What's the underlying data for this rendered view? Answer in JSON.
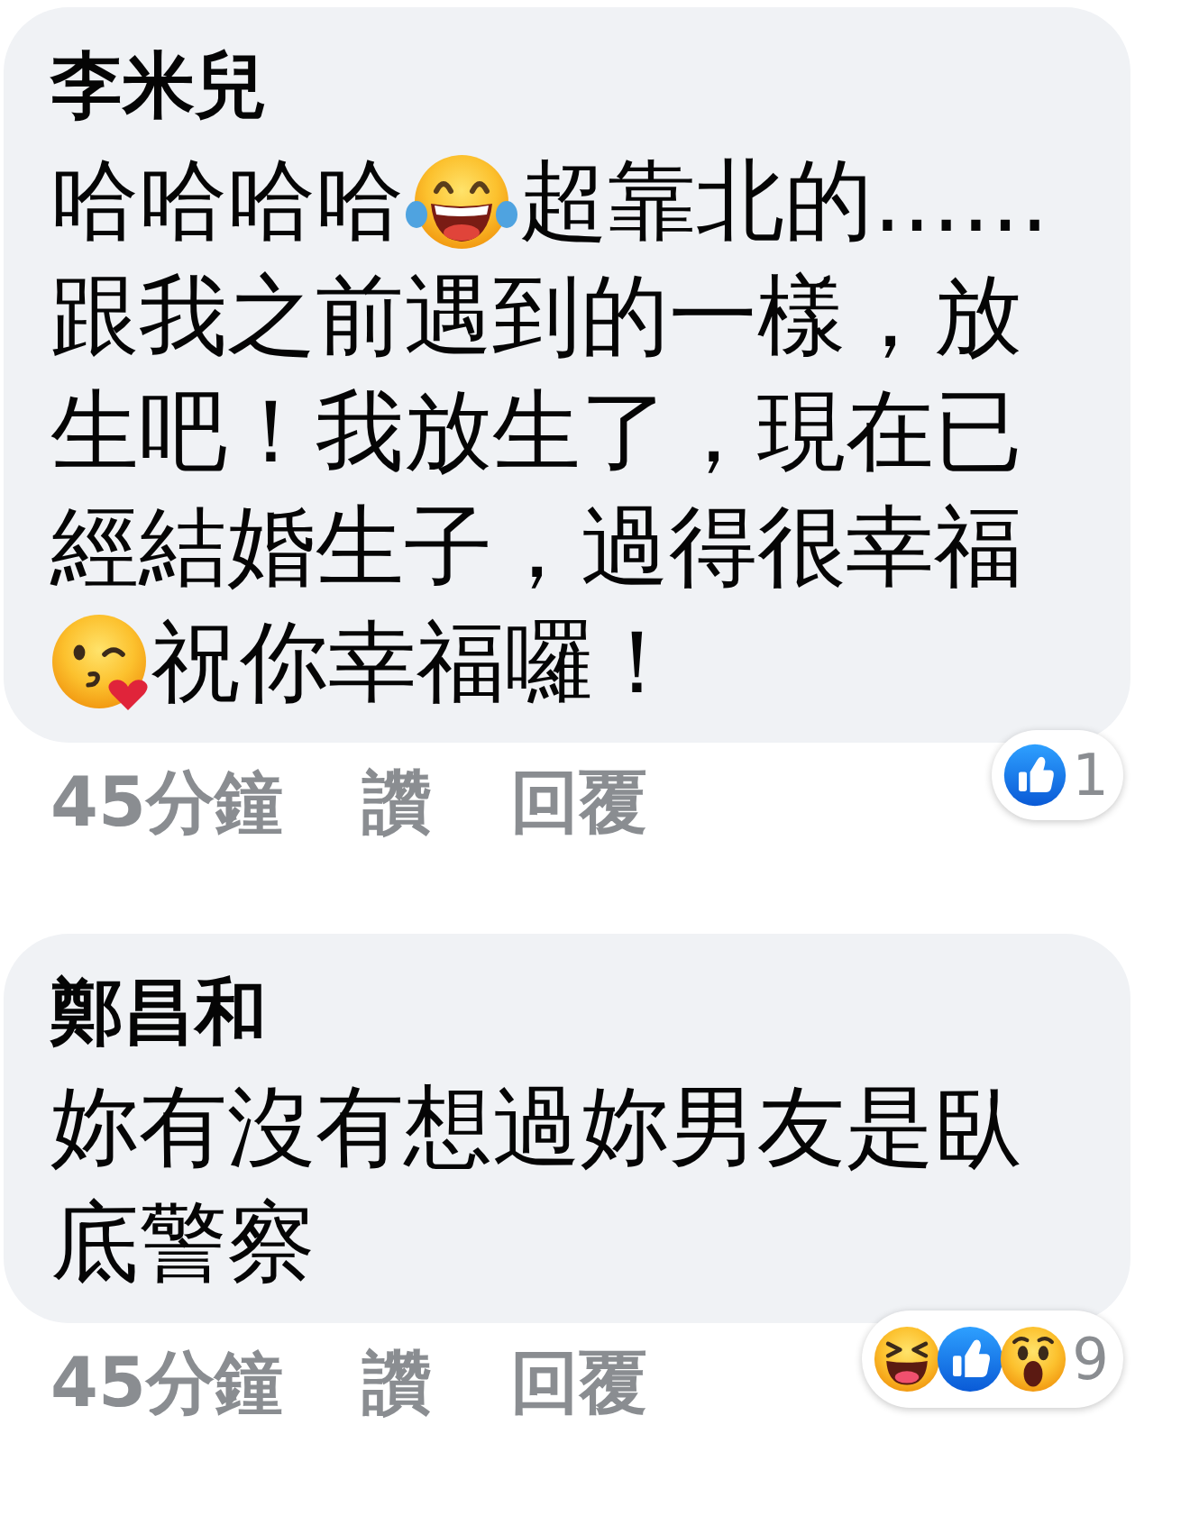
{
  "comments": [
    {
      "author": "李米兒",
      "lines": [
        [
          {
            "kind": "text",
            "text": "哈哈哈哈"
          },
          {
            "kind": "laugh"
          },
          {
            "kind": "text",
            "text": "超靠北的……"
          }
        ],
        [
          {
            "kind": "text",
            "text": "跟我之前遇到的一樣，放"
          }
        ],
        [
          {
            "kind": "text",
            "text": "生吧！我放生了，現在已"
          }
        ],
        [
          {
            "kind": "text",
            "text": "經結婚生子，過得很幸福"
          }
        ],
        [
          {
            "kind": "kiss"
          },
          {
            "kind": "text",
            "text": "祝你幸福囉！"
          }
        ]
      ],
      "time": "45分鐘",
      "actions": [
        "讚",
        "回覆"
      ],
      "reactions": [
        {
          "kind": "like"
        }
      ],
      "reaction_count": "1"
    },
    {
      "author": "鄭昌和",
      "lines": [
        [
          {
            "kind": "text",
            "text": "妳有沒有想過妳男友是臥"
          }
        ],
        [
          {
            "kind": "text",
            "text": "底警察"
          }
        ]
      ],
      "time": "45分鐘",
      "actions": [
        "讚",
        "回覆"
      ],
      "reactions": [
        {
          "kind": "haha"
        },
        {
          "kind": "like"
        },
        {
          "kind": "wow"
        }
      ],
      "reaction_count": "9"
    }
  ]
}
